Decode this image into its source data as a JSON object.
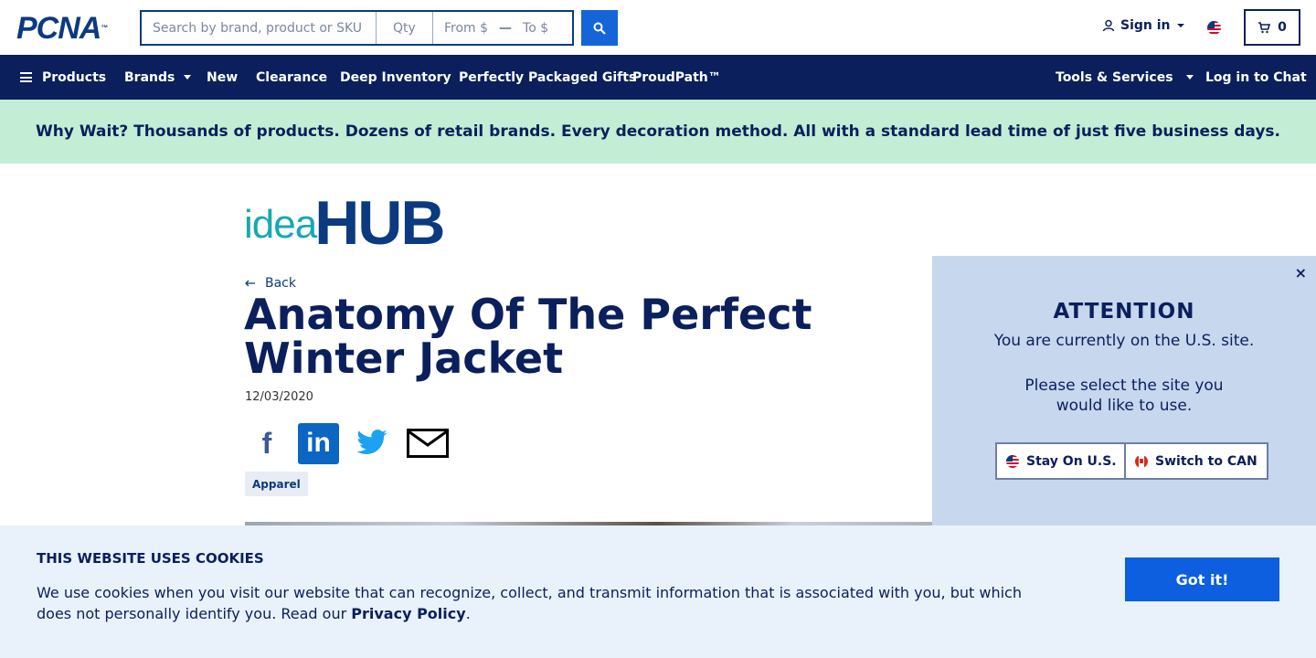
{
  "header": {
    "logo_text": "PCNA",
    "logo_tm": "™",
    "search_placeholder": "Search by brand, product or SKU",
    "qty_placeholder": "Qty",
    "price_from_placeholder": "From $",
    "price_separator": "—",
    "price_to_placeholder": "To $",
    "signin_label": "Sign in",
    "cart_count": "0"
  },
  "nav": {
    "items": [
      {
        "label": "Products"
      },
      {
        "label": "Brands"
      },
      {
        "label": "New"
      },
      {
        "label": "Clearance"
      },
      {
        "label": "Deep Inventory"
      },
      {
        "label": "Perfectly Packaged Gifts"
      },
      {
        "label": "ProudPath™"
      }
    ],
    "tools_label": "Tools & Services",
    "chat_label": "Log in to Chat"
  },
  "promo": {
    "text": "Why Wait? Thousands of products. Dozens of retail brands. Every decoration method. All with a standard lead time of just five business days."
  },
  "article": {
    "brand_idea": "idea",
    "brand_hub": "HUB",
    "back_label": "Back",
    "title": "Anatomy Of The Perfect Winter Jacket",
    "date": "12/03/2020",
    "share_icons": [
      "facebook-icon",
      "linkedin-icon",
      "twitter-icon",
      "email-icon"
    ],
    "tag": "Apparel"
  },
  "attention": {
    "close": "×",
    "title": "ATTENTION",
    "line1": "You are currently on the U.S. site.",
    "line2": "Please select the site you",
    "line3": "would like to use.",
    "stay_label": "Stay On U.S.",
    "switch_label": "Switch to CAN"
  },
  "cookie": {
    "title": "THIS WEBSITE USES COOKIES",
    "text": "We use cookies when you visit our website that can recognize, collect, and transmit information that is associated with you, but which does not personally identify you. Read our ",
    "link": "Privacy Policy",
    "end": ".",
    "button": "Got it!"
  },
  "colors": {
    "navy": "#0b1f5c",
    "brand_blue": "#0c3a80",
    "action_blue": "#1565d8",
    "promo_green": "#c3eed5",
    "popup_bg": "#c6d7ee",
    "cookie_bg": "#e9f1fb"
  }
}
